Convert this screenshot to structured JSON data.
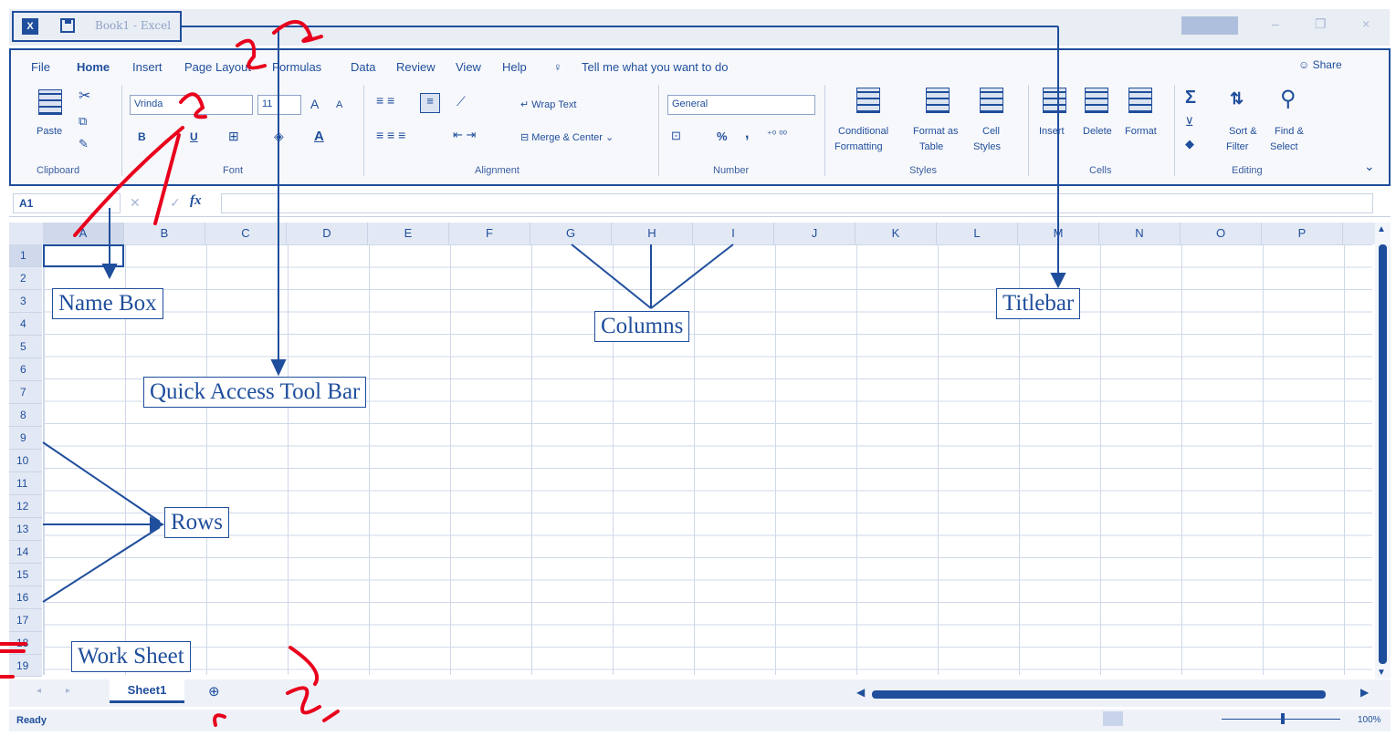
{
  "titlebar": {
    "app_icon": "X",
    "title": "Book1 - Excel",
    "minimize": "–",
    "restore": "❐",
    "close": "×"
  },
  "menu": {
    "items": [
      "File",
      "Home",
      "Insert",
      "Page Layout",
      "Formulas",
      "Data",
      "Review",
      "View",
      "Help"
    ],
    "tell_me": "Tell me what you want to do",
    "share": "Share"
  },
  "ribbon": {
    "clipboard": {
      "paste": "Paste",
      "label": "Clipboard"
    },
    "font": {
      "font_name": "Vrinda",
      "font_size": "11",
      "bold": "B",
      "underline": "U",
      "grow": "A",
      "shrink": "A",
      "color": "A",
      "label": "Font"
    },
    "alignment": {
      "wrap_text": "Wrap Text",
      "merge_center": "Merge & Center",
      "label": "Alignment"
    },
    "number": {
      "format": "General",
      "percent": "%",
      "comma": ",",
      "label": "Number"
    },
    "styles": {
      "conditional": "Conditional",
      "conditional2": "Formatting",
      "format_as": "Format as",
      "format_as2": "Table",
      "cell": "Cell",
      "cell2": "Styles",
      "label": "Styles"
    },
    "cells": {
      "insert": "Insert",
      "delete": "Delete",
      "format": "Format",
      "label": "Cells"
    },
    "editing": {
      "sort": "Sort &",
      "sort2": "Filter",
      "find": "Find &",
      "find2": "Select",
      "label": "Editing"
    }
  },
  "formula_bar": {
    "name_box": "A1",
    "fx": "fx"
  },
  "columns": [
    "A",
    "B",
    "C",
    "D",
    "E",
    "F",
    "G",
    "H",
    "I",
    "J",
    "K",
    "L",
    "M",
    "N",
    "O",
    "P"
  ],
  "rows": [
    "1",
    "2",
    "3",
    "4",
    "5",
    "6",
    "7",
    "8",
    "9",
    "10",
    "11",
    "12",
    "13",
    "14",
    "15",
    "16",
    "17",
    "18",
    "19"
  ],
  "sheet_tabs": {
    "active": "Sheet1",
    "add": "⊕"
  },
  "status": {
    "ready": "Ready",
    "zoom": "100%"
  },
  "annotations": {
    "name_box": "Name Box",
    "quick_access": "Quick Access Tool Bar",
    "columns": "Columns",
    "titlebar": "Titlebar",
    "rows": "Rows",
    "work_sheet": "Work Sheet"
  },
  "colors": {
    "accent": "#1f4e9c",
    "scribble": "#e8001c"
  }
}
